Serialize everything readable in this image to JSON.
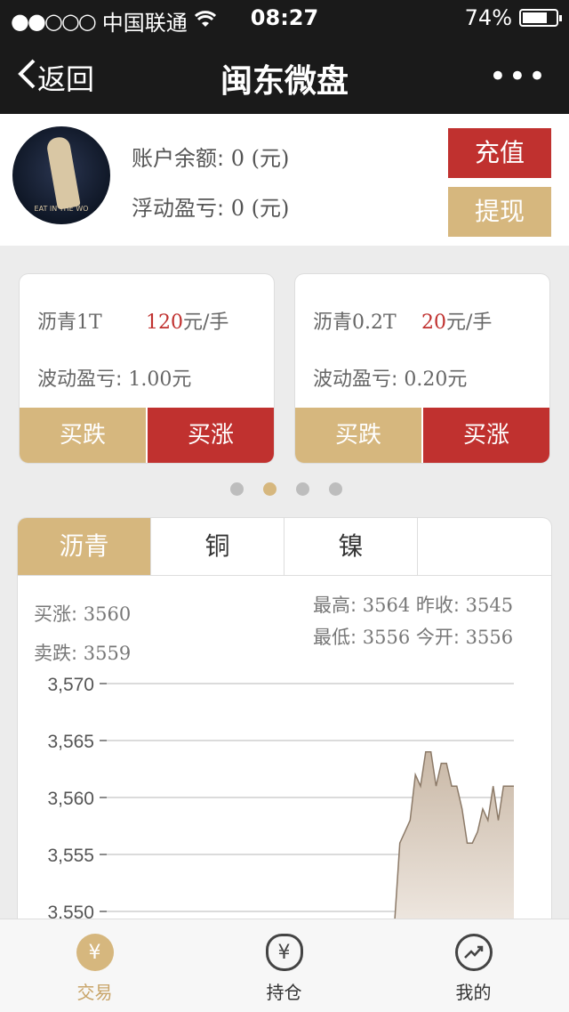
{
  "status": {
    "carrier": "中国联通",
    "time": "08:27",
    "battery": "74%",
    "battery_level": 0.74
  },
  "nav": {
    "back": "返回",
    "title": "闽东微盘",
    "more": "•••"
  },
  "account": {
    "balance_label": "账户余额:",
    "balance_value": "0",
    "balance_unit": "(元)",
    "pnl_label": "浮动盈亏:",
    "pnl_value": "0",
    "pnl_unit": "(元)",
    "recharge": "充值",
    "withdraw": "提现",
    "avatar_caption": "EAT IN THE WO"
  },
  "products": [
    {
      "name": "沥青1T",
      "price": "120",
      "price_unit": "元/手",
      "fluct_label": "波动盈亏:",
      "fluct_value": "1.00元",
      "buy_down": "买跌",
      "buy_up": "买涨"
    },
    {
      "name": "沥青0.2T",
      "price": "20",
      "price_unit": "元/手",
      "fluct_label": "波动盈亏:",
      "fluct_value": "0.20元",
      "buy_down": "买跌",
      "buy_up": "买涨"
    }
  ],
  "carousel": {
    "count": 4,
    "active": 1
  },
  "market": {
    "tabs": [
      "沥青",
      "铜",
      "镍",
      ""
    ],
    "buy_up_label": "买涨:",
    "buy_up_value": "3560",
    "sell_down_label": "卖跌:",
    "sell_down_value": "3559",
    "high_label": "最高:",
    "high_value": "3564",
    "prev_close_label": "昨收:",
    "prev_close_value": "3545",
    "low_label": "最低:",
    "low_value": "3556",
    "open_label": "今开:",
    "open_value": "3556"
  },
  "chart_data": {
    "type": "area",
    "y_ticks": [
      "3,570",
      "3,565",
      "3,560",
      "3,555",
      "3,550"
    ],
    "ylim": [
      3549,
      3570
    ],
    "grid": true,
    "values": [
      3549,
      3549,
      3556,
      3557,
      3558,
      3562,
      3561,
      3564,
      3564,
      3561,
      3563,
      3563,
      3561,
      3561,
      3559,
      3556,
      3556,
      3557,
      3559,
      3558,
      3561,
      3558,
      3561,
      3561,
      3561
    ],
    "fill_color": "#c9b8a6",
    "line_color": "#8c7a68"
  },
  "tabbar": [
    {
      "label": "交易",
      "icon": "yen-coin-icon",
      "glyph": "¥"
    },
    {
      "label": "持仓",
      "icon": "money-bag-icon",
      "glyph": "¥"
    },
    {
      "label": "我的",
      "icon": "trend-icon",
      "glyph": ""
    }
  ],
  "colors": {
    "accent_gold": "#d6b77e",
    "accent_red": "#c0312f",
    "dark_bar": "#1a1a1a"
  }
}
